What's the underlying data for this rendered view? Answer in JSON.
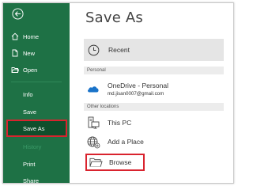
{
  "sidebar": {
    "items": {
      "home": "Home",
      "new": "New",
      "open": "Open",
      "info": "Info",
      "save": "Save",
      "save_as": "Save As",
      "history": "History",
      "print": "Print",
      "share": "Share"
    },
    "active_item": "Save As",
    "colors": {
      "background": "#1e7145",
      "active_background": "#0f4f2c",
      "highlight_border": "#d9232e"
    }
  },
  "main": {
    "title": "Save As",
    "recent_label": "Recent",
    "personal_header": "Personal",
    "onedrive": {
      "name": "OneDrive - Personal",
      "email": "md.jisan0007@gmail.com"
    },
    "other_header": "Other locations",
    "this_pc": "This PC",
    "add_place": "Add a Place",
    "browse": "Browse"
  },
  "icons": [
    "back-arrow-icon",
    "home-icon",
    "new-document-icon",
    "open-folder-icon",
    "clock-icon",
    "cloud-icon",
    "pc-icon",
    "globe-icon",
    "folder-icon"
  ]
}
